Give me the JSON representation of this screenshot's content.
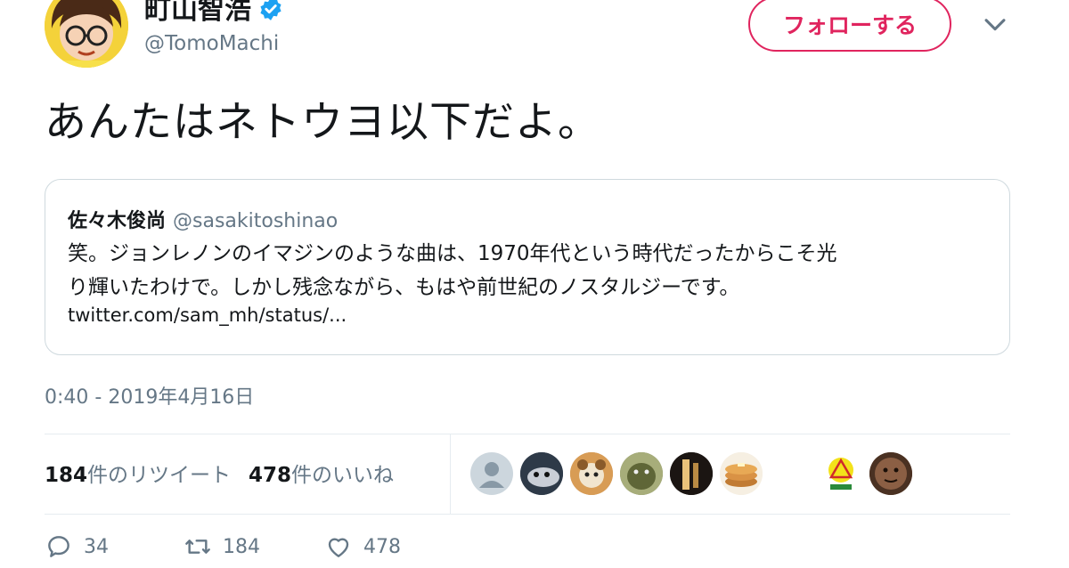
{
  "author": {
    "display_name": "町山智浩",
    "handle": "@TomoMachi",
    "verified": true
  },
  "follow_button_label": "フォローする",
  "tweet_text": "あんたはネトウヨ以下だよ。",
  "quoted_tweet": {
    "name": "佐々木俊尚",
    "handle": "@sasakitoshinao",
    "text_lines": [
      "笑。ジョンレノンのイマジンのような曲は、1970年代という時代だったからこそ光",
      "り輝いたわけで。しかし残念ながら、もはや前世紀のノスタルジーです。"
    ],
    "link": "twitter.com/sam_mh/status/..."
  },
  "timestamp": "0:40 - 2019年4月16日",
  "stats": {
    "retweets_count": "184",
    "retweets_label": "件のリツイート",
    "likes_count": "478",
    "likes_label": "件のいいね"
  },
  "actions": {
    "reply_count": "34",
    "retweet_count": "184",
    "like_count": "478"
  },
  "colors": {
    "follow": "#e0245e",
    "verified": "#1da1f2",
    "muted": "#657786"
  },
  "icons": [
    "verified-badge-icon",
    "chevron-down-icon",
    "reply-icon",
    "retweet-icon",
    "heart-icon"
  ]
}
